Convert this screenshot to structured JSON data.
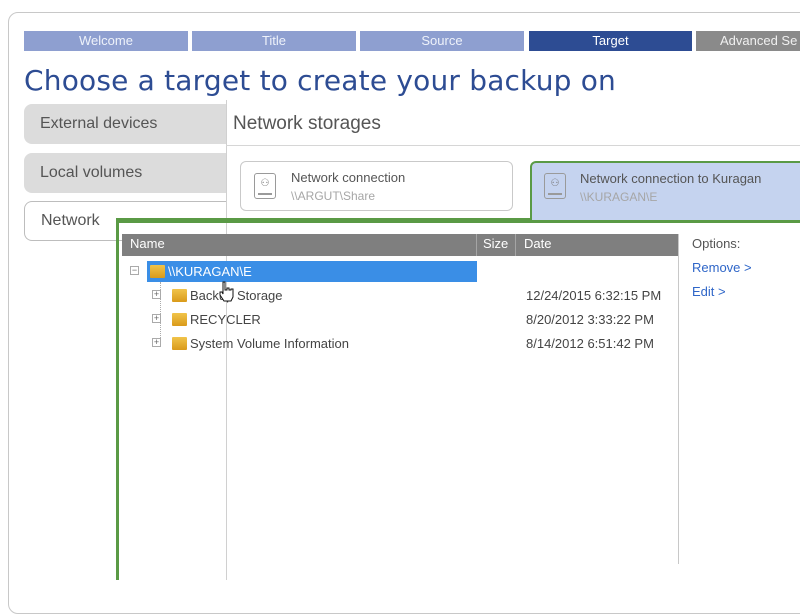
{
  "wizard": {
    "steps": [
      {
        "label": "Welcome",
        "state": "inactive"
      },
      {
        "label": "Title",
        "state": "inactive"
      },
      {
        "label": "Source",
        "state": "inactive"
      },
      {
        "label": "Target",
        "state": "active"
      },
      {
        "label": "Advanced Se",
        "state": "future"
      }
    ]
  },
  "title": "Choose a target to create your backup on",
  "target_tabs": [
    {
      "label": "External devices"
    },
    {
      "label": "Local volumes"
    },
    {
      "label": "Network"
    }
  ],
  "panel": {
    "header": "Network storages",
    "connections": [
      {
        "title": "Network connection",
        "path": "\\\\ARGUT\\Share"
      },
      {
        "title": "Network connection to Kuragan",
        "path": "\\\\KURAGAN\\E"
      }
    ]
  },
  "tree": {
    "columns": [
      "Name",
      "Size",
      "Date"
    ],
    "root": {
      "label": "\\\\KURAGAN\\E"
    },
    "items": [
      {
        "label": "Backup Storage",
        "date": "12/24/2015 6:32:15 PM"
      },
      {
        "label": "RECYCLER",
        "date": "8/20/2012 3:33:22 PM"
      },
      {
        "label": "System Volume Information",
        "date": "8/14/2012 6:51:42 PM"
      }
    ]
  },
  "options": {
    "heading": "Options:",
    "remove": "Remove >",
    "edit": "Edit >"
  },
  "colors": {
    "accent": "#2d4c93",
    "step_inactive": "#8e9fd0",
    "selection_border": "#5a9a45",
    "selection_fill": "#c5d3ef",
    "tree_selection": "#3a8ee6"
  }
}
